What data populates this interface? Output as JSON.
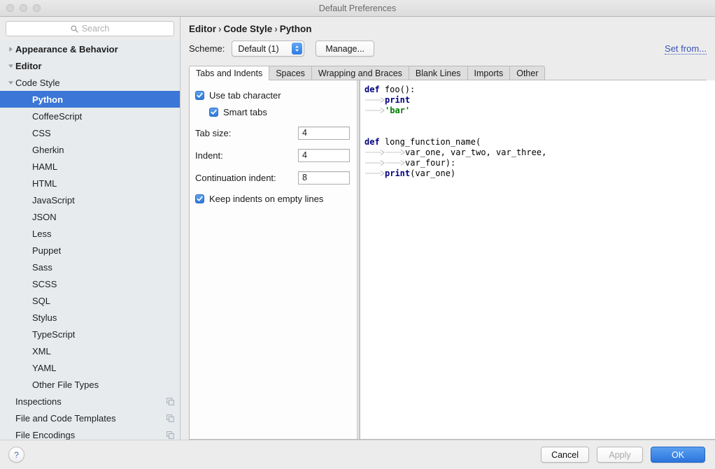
{
  "window": {
    "title": "Default Preferences",
    "traffic_lights": [
      "close-button",
      "minimize-button",
      "zoom-button"
    ]
  },
  "sidebar": {
    "search": {
      "placeholder": "Search",
      "value": "",
      "icon": "search-icon"
    },
    "items": [
      {
        "label": "Appearance & Behavior",
        "level": 0,
        "bold": true,
        "twisty": "collapsed",
        "selected": false,
        "icon": ""
      },
      {
        "label": "Editor",
        "level": 0,
        "bold": true,
        "twisty": "expanded",
        "selected": false,
        "icon": ""
      },
      {
        "label": "Code Style",
        "level": 1,
        "bold": false,
        "twisty": "expanded",
        "selected": false,
        "icon": ""
      },
      {
        "label": "Python",
        "level": 2,
        "bold": true,
        "twisty": "none",
        "selected": true,
        "icon": ""
      },
      {
        "label": "CoffeeScript",
        "level": 2,
        "bold": false,
        "twisty": "none",
        "selected": false,
        "icon": ""
      },
      {
        "label": "CSS",
        "level": 2,
        "bold": false,
        "twisty": "none",
        "selected": false,
        "icon": ""
      },
      {
        "label": "Gherkin",
        "level": 2,
        "bold": false,
        "twisty": "none",
        "selected": false,
        "icon": ""
      },
      {
        "label": "HAML",
        "level": 2,
        "bold": false,
        "twisty": "none",
        "selected": false,
        "icon": ""
      },
      {
        "label": "HTML",
        "level": 2,
        "bold": false,
        "twisty": "none",
        "selected": false,
        "icon": ""
      },
      {
        "label": "JavaScript",
        "level": 2,
        "bold": false,
        "twisty": "none",
        "selected": false,
        "icon": ""
      },
      {
        "label": "JSON",
        "level": 2,
        "bold": false,
        "twisty": "none",
        "selected": false,
        "icon": ""
      },
      {
        "label": "Less",
        "level": 2,
        "bold": false,
        "twisty": "none",
        "selected": false,
        "icon": ""
      },
      {
        "label": "Puppet",
        "level": 2,
        "bold": false,
        "twisty": "none",
        "selected": false,
        "icon": ""
      },
      {
        "label": "Sass",
        "level": 2,
        "bold": false,
        "twisty": "none",
        "selected": false,
        "icon": ""
      },
      {
        "label": "SCSS",
        "level": 2,
        "bold": false,
        "twisty": "none",
        "selected": false,
        "icon": ""
      },
      {
        "label": "SQL",
        "level": 2,
        "bold": false,
        "twisty": "none",
        "selected": false,
        "icon": ""
      },
      {
        "label": "Stylus",
        "level": 2,
        "bold": false,
        "twisty": "none",
        "selected": false,
        "icon": ""
      },
      {
        "label": "TypeScript",
        "level": 2,
        "bold": false,
        "twisty": "none",
        "selected": false,
        "icon": ""
      },
      {
        "label": "XML",
        "level": 2,
        "bold": false,
        "twisty": "none",
        "selected": false,
        "icon": ""
      },
      {
        "label": "YAML",
        "level": 2,
        "bold": false,
        "twisty": "none",
        "selected": false,
        "icon": ""
      },
      {
        "label": "Other File Types",
        "level": 2,
        "bold": false,
        "twisty": "none",
        "selected": false,
        "icon": ""
      },
      {
        "label": "Inspections",
        "level": 1,
        "bold": false,
        "twisty": "none",
        "selected": false,
        "icon": "copy-icon"
      },
      {
        "label": "File and Code Templates",
        "level": 1,
        "bold": false,
        "twisty": "none",
        "selected": false,
        "icon": "copy-icon"
      },
      {
        "label": "File Encodings",
        "level": 1,
        "bold": false,
        "twisty": "none",
        "selected": false,
        "icon": "copy-icon"
      }
    ]
  },
  "main": {
    "breadcrumb": [
      "Editor",
      "Code Style",
      "Python"
    ],
    "breadcrumb_separator": "›",
    "scheme": {
      "label": "Scheme:",
      "value": "Default (1)",
      "manage_label": "Manage...",
      "set_from_label": "Set from..."
    },
    "tabs": [
      {
        "label": "Tabs and Indents",
        "active": true
      },
      {
        "label": "Spaces",
        "active": false
      },
      {
        "label": "Wrapping and Braces",
        "active": false
      },
      {
        "label": "Blank Lines",
        "active": false
      },
      {
        "label": "Imports",
        "active": false
      },
      {
        "label": "Other",
        "active": false
      }
    ],
    "settings": {
      "use_tab_character": {
        "label": "Use tab character",
        "checked": true
      },
      "smart_tabs": {
        "label": "Smart tabs",
        "checked": true
      },
      "tab_size": {
        "label": "Tab size:",
        "value": "4"
      },
      "indent": {
        "label": "Indent:",
        "value": "4"
      },
      "continuation_indent": {
        "label": "Continuation indent:",
        "value": "8"
      },
      "keep_indents_on_empty_lines": {
        "label": "Keep indents on empty lines",
        "checked": true
      }
    },
    "preview": {
      "lines": [
        {
          "tabs": 0,
          "tokens": [
            {
              "t": "def",
              "c": "kw"
            },
            {
              "t": " foo():",
              "c": "plain"
            }
          ]
        },
        {
          "tabs": 1,
          "tokens": [
            {
              "t": "print",
              "c": "kw"
            }
          ]
        },
        {
          "tabs": 1,
          "tokens": [
            {
              "t": "'bar'",
              "c": "str"
            }
          ]
        },
        {
          "tabs": 0,
          "tokens": []
        },
        {
          "tabs": 0,
          "tokens": []
        },
        {
          "tabs": 0,
          "tokens": [
            {
              "t": "def",
              "c": "kw"
            },
            {
              "t": " long_function_name(",
              "c": "plain"
            }
          ]
        },
        {
          "tabs": 2,
          "tokens": [
            {
              "t": "var_one, var_two, var_three,",
              "c": "plain"
            }
          ]
        },
        {
          "tabs": 2,
          "tokens": [
            {
              "t": "var_four):",
              "c": "plain"
            }
          ]
        },
        {
          "tabs": 1,
          "tokens": [
            {
              "t": "print",
              "c": "kw"
            },
            {
              "t": "(var_one)",
              "c": "plain"
            }
          ]
        }
      ]
    }
  },
  "footer": {
    "help_label": "?",
    "cancel_label": "Cancel",
    "apply_label": "Apply",
    "apply_disabled": true,
    "ok_label": "OK"
  },
  "colors": {
    "selection_blue": "#3c76d6",
    "default_button_blue": "#2b74dd",
    "link_indigo": "#3a54b4",
    "sidebar_bg": "#e8ebee",
    "window_bg": "#ececec",
    "keyword_navy": "#000080",
    "string_green": "#008000"
  }
}
